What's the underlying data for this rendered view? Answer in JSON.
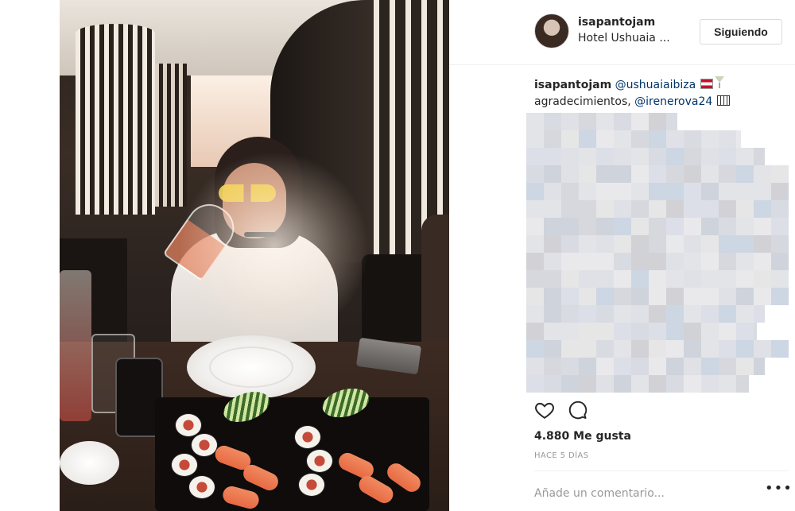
{
  "post": {
    "username": "isapantojam",
    "location": "Hotel Ushuaia ...",
    "follow_label": "Siguiendo",
    "caption": {
      "author": "isapantojam",
      "mention1": "@ushuaiaibiza",
      "text": "agradecimientos,",
      "mention2": "@irenerova24"
    },
    "likes": "4.880 Me gusta",
    "timestamp": "HACE 5 DÍAS",
    "comment_placeholder": "Añade un comentario...",
    "more_glyph": "•••"
  },
  "icons": {
    "like": "heart-outline-icon",
    "comment": "comment-bubble-icon",
    "flag": "spain-flag-emoji",
    "drink": "cocktail-emoji",
    "photo": "grid-emoji"
  },
  "colors": {
    "mention": "#003569",
    "text": "#262626",
    "muted": "#999999",
    "border": "#efefef"
  }
}
